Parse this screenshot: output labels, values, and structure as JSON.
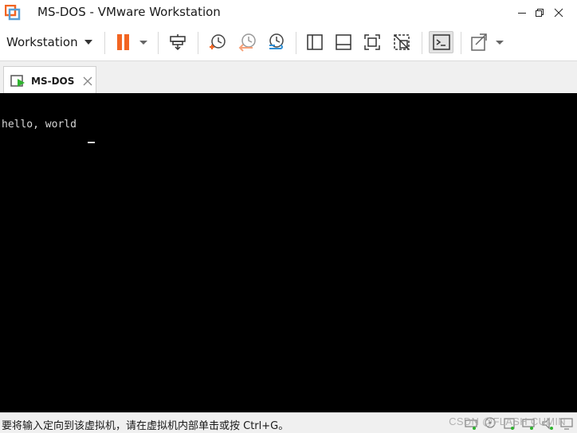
{
  "window": {
    "title": "MS-DOS - VMware Workstation",
    "icons": [
      "vmware-logo-icon",
      "minimize-icon",
      "restore-icon",
      "close-icon"
    ]
  },
  "toolbar": {
    "workstation_label": "Workstation",
    "buttons": [
      "pause-icon",
      "send-ctrl-alt-del-icon",
      "snapshot-take-icon",
      "snapshot-revert-icon",
      "snapshot-manager-icon",
      "library-view-icon",
      "thumbnail-bar-icon",
      "full-screen-icon",
      "unity-icon",
      "console-view-icon",
      "stretch-view-icon"
    ]
  },
  "tab": {
    "label": "MS-DOS"
  },
  "console": {
    "line1": "hello, world"
  },
  "statusbar": {
    "message": "要将输入定向到该虚拟机，请在虚拟机内部单击或按 Ctrl+G。",
    "watermark": "CSDN @FLASH CUMIN"
  },
  "colors": {
    "accent_orange": "#f26522",
    "snapshot_blue": "#2e8fd6",
    "console_bg": "#000000",
    "console_text": "#d8d8d8",
    "status_green": "#2fb32f"
  }
}
